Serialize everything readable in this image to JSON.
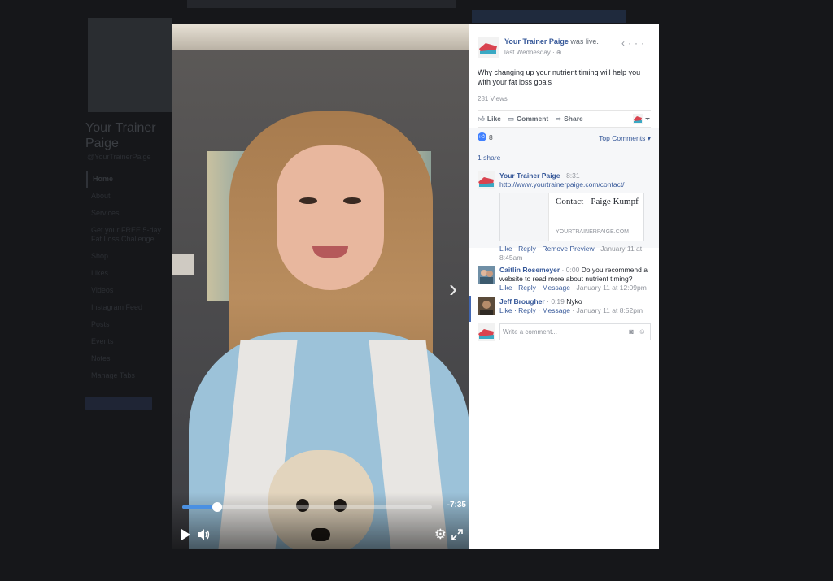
{
  "background": {
    "page_name": "Your Trainer Paige",
    "handle": "@YourTrainerPaige",
    "nav": [
      "Home",
      "About",
      "Services",
      "Get your FREE 5-day Fat Loss Challenge",
      "Shop",
      "Likes",
      "Videos",
      "Instagram Feed",
      "Posts",
      "Events",
      "Notes",
      "Manage Tabs"
    ]
  },
  "video": {
    "time_remaining": "-7:35",
    "progress": 0.14
  },
  "post": {
    "author": "Your Trainer Paige",
    "status": "was live.",
    "time": "last Wednesday",
    "privacy_icon": "globe-icon",
    "text": "Why changing up your nutrient timing will help you with your fat loss goals",
    "views": "281 Views"
  },
  "actions": {
    "like": "Like",
    "comment": "Comment",
    "share": "Share"
  },
  "reactions": {
    "like_count": "8",
    "sort_label": "Top Comments",
    "shares": "1 share"
  },
  "comments": [
    {
      "author": "Your Trainer Paige",
      "timestamp": "8:31",
      "link": "http://www.yourtrainerpaige.com/contact/",
      "preview_title": "Contact - Paige Kumpf",
      "preview_site": "YOURTRAINERPAIGE.COM",
      "actions": "Like · Reply · Remove Preview",
      "date": "January 11 at 8:45am"
    },
    {
      "author": "Caitlin Rosemeyer",
      "timestamp": "0:00",
      "text": "Do you recommend a website to read more about nutrient timing?",
      "actions": "Like · Reply · Message",
      "date": "January 11 at 12:09pm"
    },
    {
      "author": "Jeff Brougher",
      "timestamp": "0:19",
      "text": "Nyko",
      "actions": "Like · Reply · Message",
      "date": "January 11 at 8:52pm"
    }
  ],
  "compose": {
    "placeholder": "Write a comment..."
  },
  "colors": {
    "link": "#365899",
    "accent": "#4080ff",
    "progress": "#4a90e2"
  }
}
